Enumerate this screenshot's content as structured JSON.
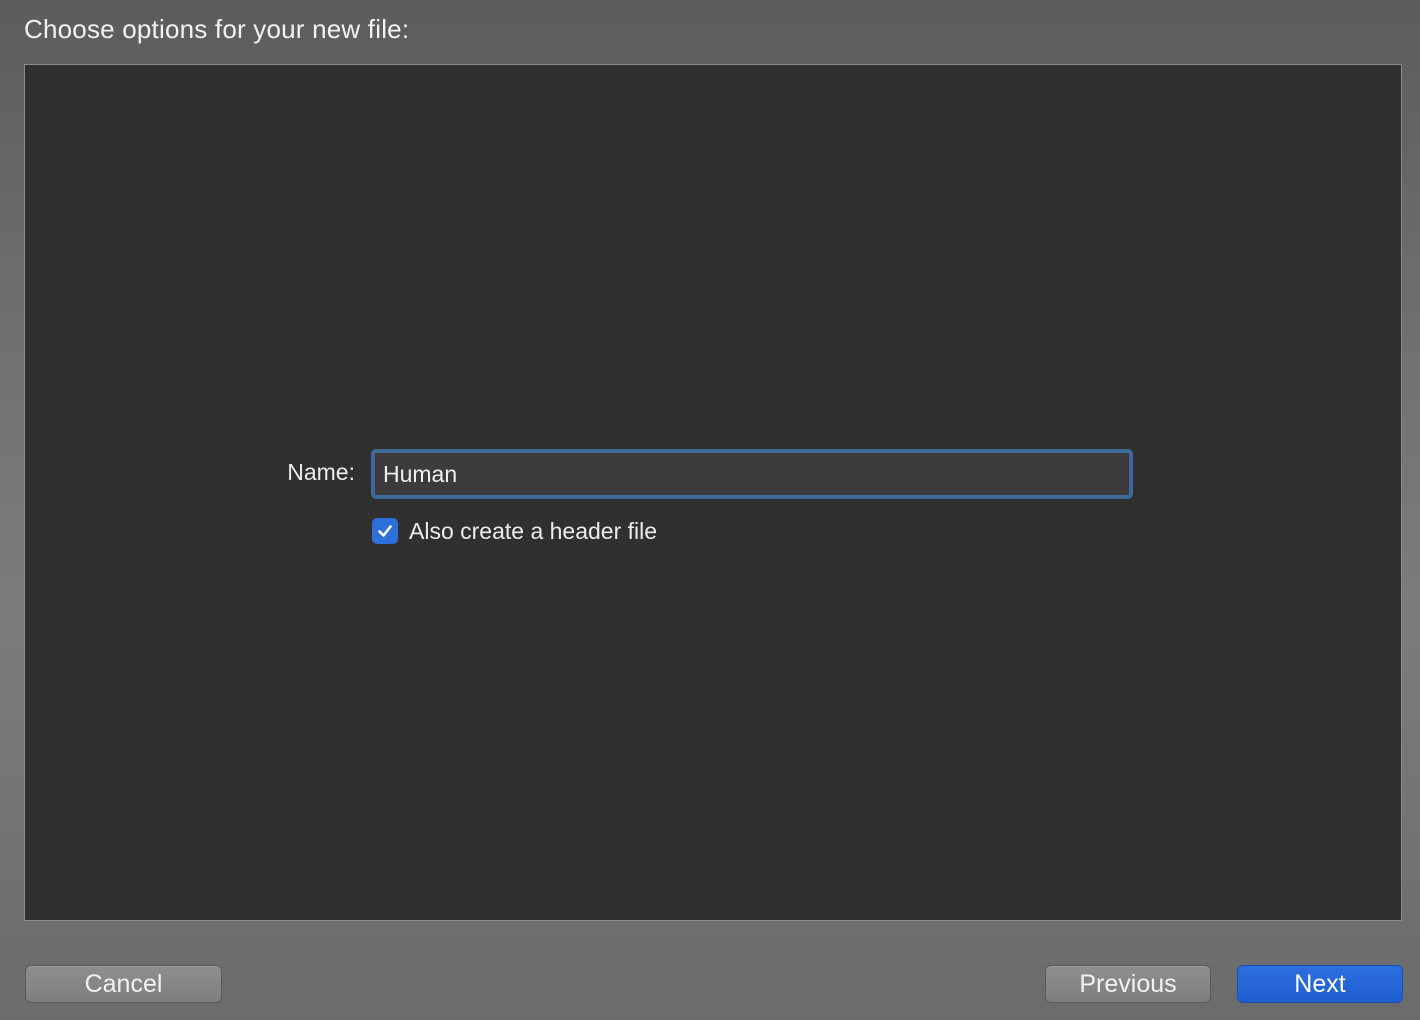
{
  "sheet": {
    "title": "Choose options for your new file:"
  },
  "form": {
    "name_label": "Name:",
    "name_value": "Human",
    "header_checkbox": {
      "label": "Also create a header file",
      "checked": true
    }
  },
  "buttons": {
    "cancel": "Cancel",
    "previous": "Previous",
    "next": "Next"
  },
  "colors": {
    "accent": "#2f6fd8",
    "focus_ring": "#3e6a99",
    "panel_bg": "#303030"
  }
}
